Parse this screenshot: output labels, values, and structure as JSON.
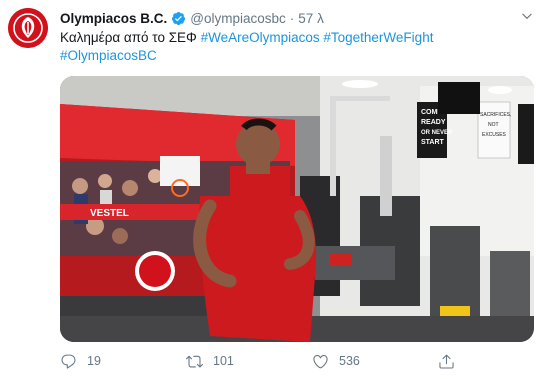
{
  "tweet": {
    "display_name": "Olympiacos B.C.",
    "handle": "@olympiacosbc",
    "time": "57 λ",
    "text_plain": "Καλημέρα από το ΣΕΦ ",
    "hashtags_line1": "#WeAreOlympiacos #TogetherWeFight",
    "hashtags_line2": "#OlympiacosBC",
    "media_text": {
      "poster_line1": "COME",
      "poster_line2": "READY",
      "poster_line3": "OR NEVER",
      "poster_line4": "START",
      "poster_right1": "SACRIFICES,",
      "poster_right2": "NOT",
      "poster_right3": "EXCUSES",
      "banner": "VESTEL"
    }
  },
  "actions": {
    "reply_count": "19",
    "retweet_count": "101",
    "like_count": "536"
  },
  "icons": {
    "avatar": "olympiacos-logo",
    "verified": "verified-badge-icon",
    "caret": "chevron-down-icon",
    "reply": "reply-icon",
    "retweet": "retweet-icon",
    "like": "heart-icon",
    "share": "share-icon"
  },
  "colors": {
    "link": "#1b95e0",
    "muted": "#657786",
    "brand_red": "#d1111b",
    "verified_blue": "#1da1f2"
  }
}
